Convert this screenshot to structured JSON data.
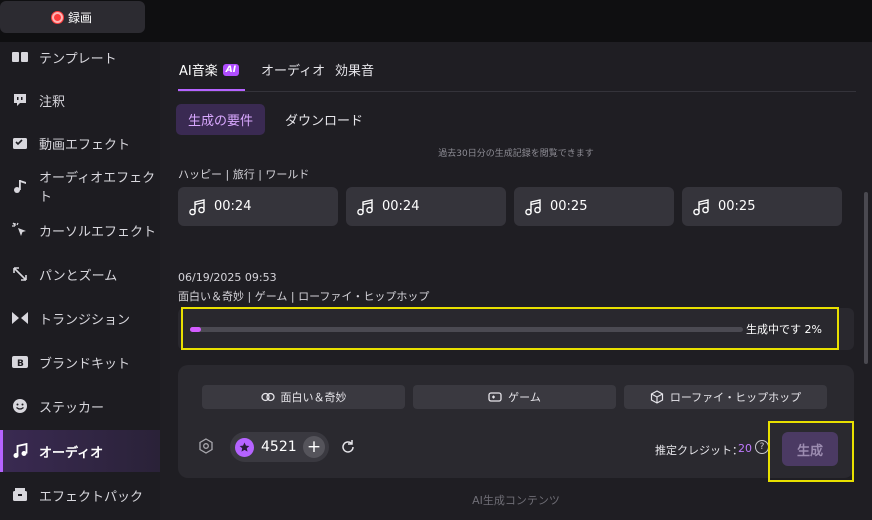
{
  "topbar": {
    "record_label": "録画"
  },
  "sidebar": {
    "items": [
      {
        "label": "テンプレート",
        "icon": "template-icon"
      },
      {
        "label": "注釈",
        "icon": "annotation-icon"
      },
      {
        "label": "動画エフェクト",
        "icon": "video-effect-icon"
      },
      {
        "label": "オーディオエフェクト",
        "icon": "audio-effect-icon"
      },
      {
        "label": "カーソルエフェクト",
        "icon": "cursor-effect-icon"
      },
      {
        "label": "パンとズーム",
        "icon": "pan-zoom-icon"
      },
      {
        "label": "トランジション",
        "icon": "transition-icon"
      },
      {
        "label": "ブランドキット",
        "icon": "brand-kit-icon"
      },
      {
        "label": "ステッカー",
        "icon": "sticker-icon"
      },
      {
        "label": "オーディオ",
        "icon": "music-note-icon"
      },
      {
        "label": "エフェクトパック",
        "icon": "effect-pack-icon"
      }
    ],
    "active_index": 9
  },
  "tabs": {
    "items": [
      {
        "label": "AI音楽",
        "badge": "AI"
      },
      {
        "label": "オーディオ"
      },
      {
        "label": "効果音"
      }
    ],
    "active_index": 0
  },
  "subtabs": {
    "active": "生成の要件",
    "other": "ダウンロード"
  },
  "history_hint": "過去30日分の生成記録を閲覧できます",
  "group1": {
    "tags": "ハッピー | 旅行 | ワールド",
    "tracks": [
      "00:24",
      "00:24",
      "00:25",
      "00:25"
    ]
  },
  "group2": {
    "timestamp": "06/19/2025 09:53",
    "tags": "面白い＆奇妙 | ゲーム | ローファイ・ヒップホップ",
    "status": "生成中です 2%",
    "progress": 0.02
  },
  "panel": {
    "chips": [
      "面白い＆奇妙",
      "ゲーム",
      "ローファイ・ヒップホップ"
    ],
    "credits": "4521",
    "estimate_label": "推定クレジット：",
    "estimate_value": "20",
    "help_symbol": "?",
    "generate_label": "生成"
  },
  "footer": "AI生成コンテンツ",
  "colors": {
    "accent": "#b563ff",
    "highlight": "#e8e000"
  }
}
